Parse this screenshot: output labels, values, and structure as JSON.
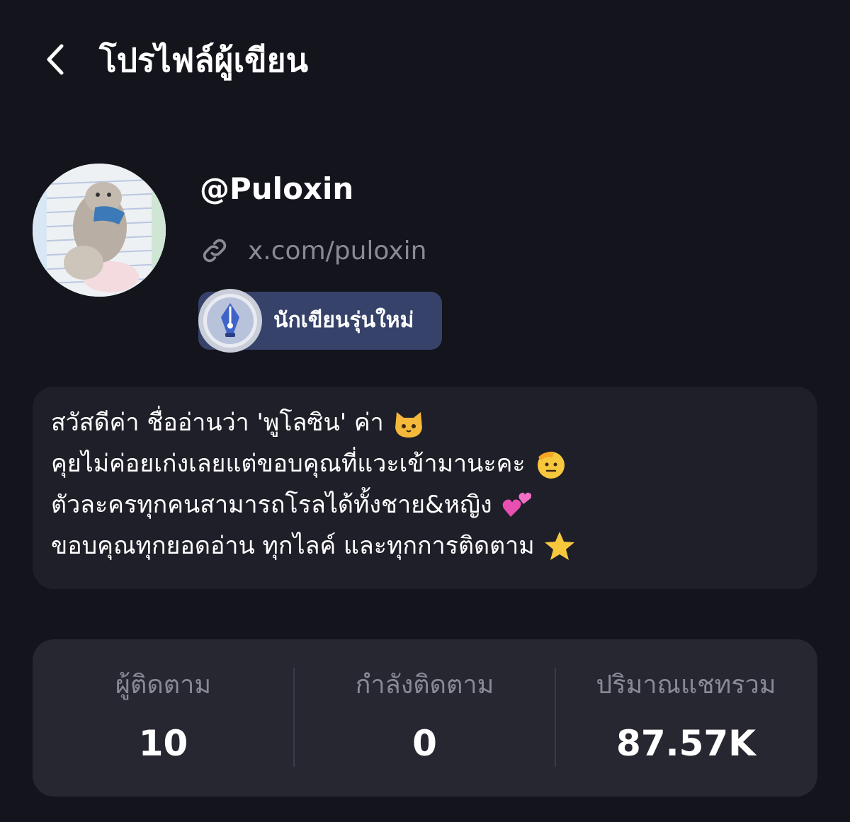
{
  "header": {
    "title": "โปรไฟล์ผู้เขียน",
    "back_icon": "chevron-left-icon"
  },
  "profile": {
    "username": "@Puloxin",
    "link_icon": "link-icon",
    "link_text": "x.com/puloxin",
    "badge_label": "นักเขียนรุ่นใหม่",
    "badge_icon": "pen-nib-medal-icon"
  },
  "bio": {
    "lines": [
      {
        "text": "สวัสดีค่า ชื่ออ่านว่า 'พูโลซิน' ค่า",
        "emoji": "cat-face-emoji"
      },
      {
        "text": "คุยไม่ค่อยเก่งเลยแต่ขอบคุณที่แวะเข้ามานะคะ",
        "emoji": "saluting-face-emoji"
      },
      {
        "text": "ตัวละครทุกคนสามารถโรลได้ทั้งชาย&หญิง",
        "emoji": "two-hearts-emoji"
      },
      {
        "text": "ขอบคุณทุกยอดอ่าน ทุกไลค์ และทุกการติดตาม",
        "emoji": "star-emoji"
      }
    ]
  },
  "stats": [
    {
      "label": "ผู้ติดตาม",
      "value": "10"
    },
    {
      "label": "กำลังติดตาม",
      "value": "0"
    },
    {
      "label": "ปริมาณแชทรวม",
      "value": "87.57K"
    }
  ],
  "colors": {
    "background": "#14141c",
    "bio_card": "#1f1f29",
    "stats_card": "#272731",
    "muted_text": "#8a8a96",
    "badge_bg": "#36426a"
  }
}
